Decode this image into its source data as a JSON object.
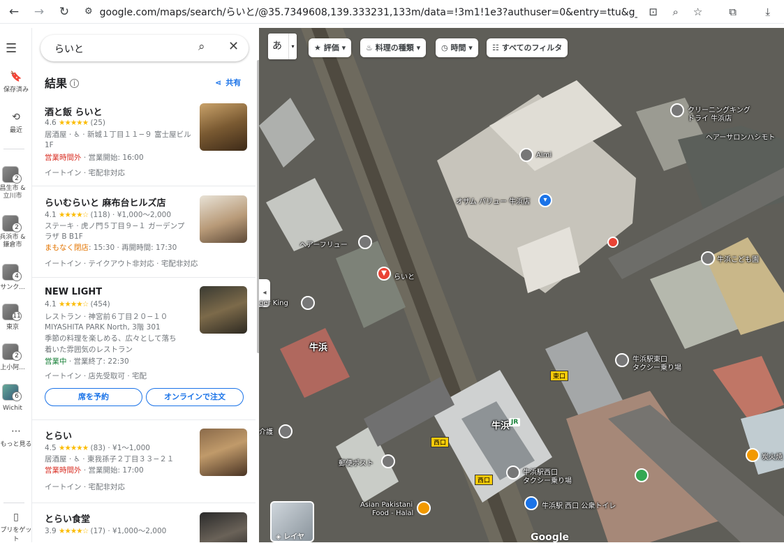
{
  "browser": {
    "url": "google.com/maps/search/らいと/@35.7349608,139.333231,133m/data=!3m1!1e3?authuser=0&entry=ttu&g_ep=EgoyMDI1..."
  },
  "rail": {
    "saved": "保存済み",
    "recent": "最近",
    "lists": [
      {
        "label": "昌生市 & 立川市",
        "count": "2"
      },
      {
        "label": "兵浜市 & 鎌倉市",
        "count": "2"
      },
      {
        "label": "サンク...",
        "count": "4"
      },
      {
        "label": "東京",
        "count": "11"
      },
      {
        "label": "上小阿...",
        "count": "2"
      },
      {
        "label": "Wichit",
        "count": "6"
      }
    ],
    "more": "もっと見る",
    "app": "プリをゲット"
  },
  "search": {
    "query": "らいと"
  },
  "results": {
    "heading": "結果",
    "share": "共有"
  },
  "cards": [
    {
      "name": "酒と飯 らいと",
      "rating": "4.6",
      "stars": "★★★★★",
      "reviews": "(25)",
      "line1": "居酒屋 · ♿ · 新城１丁目１１−９ 富士屋ビル 1F",
      "line1b": "",
      "status": "営業時間外",
      "status_rest": " · 営業開始: 16:00",
      "service": "イートイン · 宅配非対応"
    },
    {
      "name": "らいむらいと 麻布台ヒルズ店",
      "rating": "4.1",
      "stars": "★★★★☆",
      "reviews": "(118) · ¥1,000〜2,000",
      "line1": "ステーキ · 虎ノ門５丁目９−１ ガーデンプ",
      "line1b": "ラザ B B1F",
      "status": "まもなく閉店",
      "status_rest": ": 15:30 · 再開時間: 17:30",
      "service": "イートイン · テイクアウト非対応 · 宅配非対応"
    },
    {
      "name": "NEW LIGHT",
      "rating": "4.1",
      "stars": "★★★★☆",
      "reviews": "(454)",
      "line1": "レストラン · 神宮前６丁目２０−１０",
      "line1b": "MIYASHITA PARK North, 3階 301",
      "desc1": "季節の料理を楽しめる、広々として落ち",
      "desc2": "着いた雰囲気のレストラン",
      "status": "営業中",
      "status_rest": " · 営業終了: 22:30",
      "service": "イートイン · 店先受取可 · 宅配",
      "btn_reserve": "席を予約",
      "btn_order": "オンラインで注文"
    },
    {
      "name": "とらい",
      "rating": "4.5",
      "stars": "★★★★★",
      "reviews": "(83) · ¥1〜1,000",
      "line1": "居酒屋 · ♿ · 東我孫子２丁目３３−２１",
      "status": "営業時間外",
      "status_rest": " · 営業開始: 17:00",
      "service": "イートイン · 宅配非対応"
    },
    {
      "name": "とらい食堂",
      "rating": "3.9",
      "stars": "★★★★☆",
      "reviews": "(17) · ¥1,000〜2,000"
    }
  ],
  "map": {
    "lang_button": "あ",
    "chips": [
      "評価",
      "料理の種類",
      "時間",
      "すべてのフィルタ"
    ],
    "labels": {
      "aimi": "Aimi",
      "osam": "オザム バリュー 牛浜店",
      "cleaning": "クリーニングキング",
      "cleaning2": "ドライ 牛浜店",
      "hair_salon": "ヘアーサロンハシモト",
      "hair_flew": "ヘアーフリュー",
      "raito": "らいと",
      "burger_king": "ger King",
      "ushihama": "牛浜",
      "ushihama_kodomo": "牛浜こども園",
      "taxi_east": "牛浜駅東口",
      "taxi_east2": "タクシー乗り場",
      "east_exit": "東口",
      "station": "牛浜",
      "jr": "JR",
      "west_exit": "西口",
      "west_exit2": "西口",
      "post": "郵便ポスト",
      "taxi_west": "牛浜駅西口",
      "taxi_west2": "タクシー乗り場",
      "toilet": "牛浜駅 西口 公衆トイレ",
      "asian": "Asian Pakistani",
      "asian2": "Food - Halal",
      "kaigo": "介護",
      "sumiyaki": "炭火焼",
      "layers": "レイヤ",
      "google": "Google"
    }
  }
}
